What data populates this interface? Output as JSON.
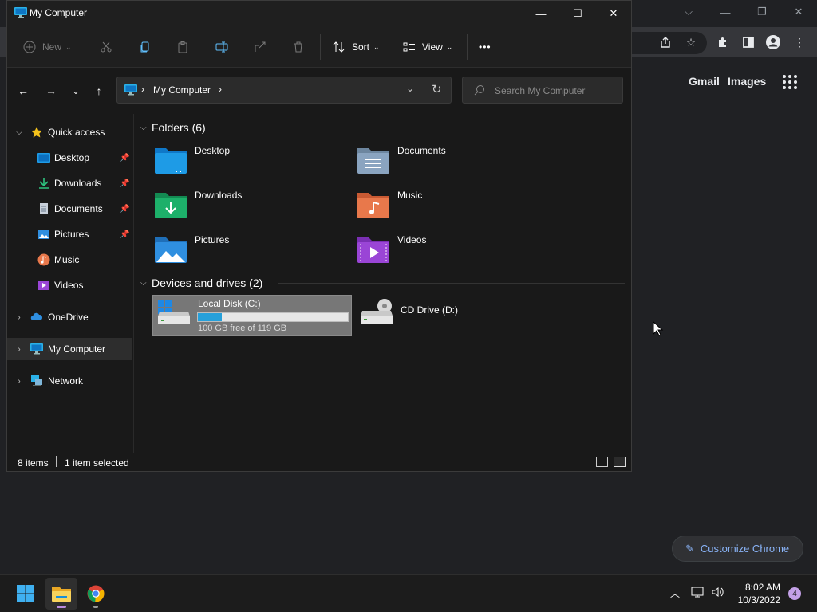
{
  "chrome": {
    "links": {
      "gmail": "Gmail",
      "images": "Images"
    },
    "customize_label": "Customize Chrome"
  },
  "explorer": {
    "title": "My Computer",
    "commands": {
      "new": "New",
      "sort": "Sort",
      "view": "View",
      "more": "•••"
    },
    "address": {
      "location": "My Computer",
      "search_placeholder": "Search My Computer"
    },
    "nav": {
      "quick_access": "Quick access",
      "items": [
        {
          "label": "Desktop",
          "pinned": true
        },
        {
          "label": "Downloads",
          "pinned": true
        },
        {
          "label": "Documents",
          "pinned": true
        },
        {
          "label": "Pictures",
          "pinned": true
        },
        {
          "label": "Music",
          "pinned": false
        },
        {
          "label": "Videos",
          "pinned": false
        }
      ],
      "onedrive": "OneDrive",
      "my_computer": "My Computer",
      "network": "Network"
    },
    "folders": {
      "header": "Folders (6)",
      "items": [
        {
          "name": "Desktop",
          "color": "#1e9be6"
        },
        {
          "name": "Documents",
          "color": "#8aa4c0"
        },
        {
          "name": "Downloads",
          "color": "#1db06a"
        },
        {
          "name": "Music",
          "color": "#e8784b"
        },
        {
          "name": "Pictures",
          "color": "#2f8fe0"
        },
        {
          "name": "Videos",
          "color": "#9a45d6"
        }
      ]
    },
    "drives": {
      "header": "Devices and drives (2)",
      "items": [
        {
          "name": "Local Disk (C:)",
          "free_text": "100 GB free of 119 GB",
          "used_fraction": 0.16,
          "selected": true
        },
        {
          "name": "CD Drive (D:)"
        }
      ]
    },
    "status": {
      "count": "8 items",
      "selection": "1 item selected"
    }
  },
  "taskbar": {
    "time": "8:02 AM",
    "date": "10/3/2022",
    "notifications": "4",
    "accent": "#0078d4"
  }
}
